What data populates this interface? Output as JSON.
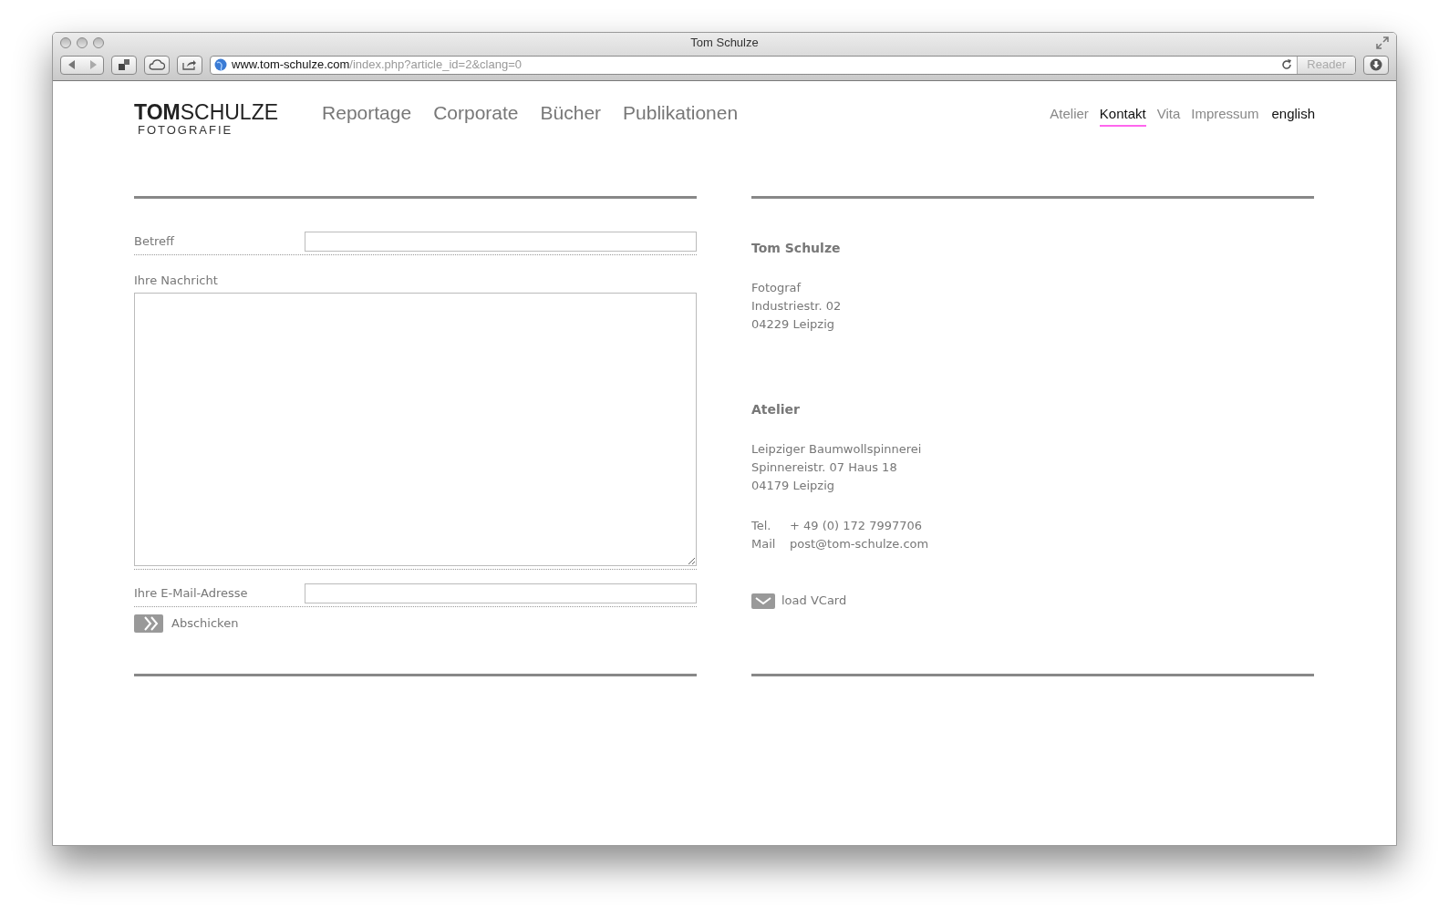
{
  "window": {
    "title": "Tom Schulze"
  },
  "toolbar": {
    "url_host": "www.tom-schulze.com",
    "url_path": "/index.php?article_id=2&clang=0",
    "reader": "Reader"
  },
  "logo": {
    "name": "**TOM**SCHULZE",
    "tagline": "FOTOGRAFIE"
  },
  "main_nav": [
    {
      "label": "Reportage",
      "selected": false
    },
    {
      "label": "Corporate",
      "selected": false
    },
    {
      "label": "Bücher",
      "selected": false
    },
    {
      "label": "Publikationen",
      "selected": false
    }
  ],
  "meta_nav": [
    {
      "label": "Atelier",
      "kind": "page",
      "selected": false
    },
    {
      "label": "Kontakt",
      "kind": "page",
      "selected": true
    },
    {
      "label": "Vita",
      "kind": "page",
      "selected": false
    },
    {
      "label": "Impressum",
      "kind": "page",
      "selected": false
    },
    {
      "label": "english",
      "kind": "language",
      "selected": false
    }
  ],
  "form": {
    "subject_label": "Betreff",
    "message_label": "Ihre Nachricht",
    "email_label": "Ihre E-Mail-Adresse",
    "submit": "Abschicken"
  },
  "contact": {
    "name": "Tom Schulze",
    "address": [
      "Fotograf",
      "Industriestr. 02",
      "04229 Leipzig"
    ],
    "atelier_title": "Atelier",
    "atelier_address": [
      "Leipziger Baumwollspinnerei",
      "Spinnereistr. 07 Haus 18",
      "04179 Leipzig"
    ],
    "details": [
      {
        "label": "Tel.",
        "value": "+ 49 (0) 172 7997706"
      },
      {
        "label": "Mail",
        "value": "post@tom-schulze.com"
      }
    ],
    "vcard": "load VCard"
  }
}
